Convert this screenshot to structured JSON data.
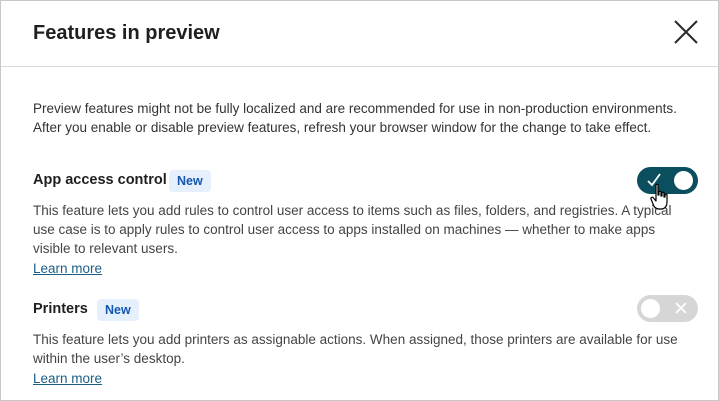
{
  "dialog": {
    "title": "Features in preview",
    "intro_line1": "Preview features might not be fully localized and are recommended for use in non-production environments.",
    "intro_line2": "After you enable or disable preview features, refresh your browser window for the change to take effect."
  },
  "features": [
    {
      "title": "App access control",
      "badge": "New",
      "description": "This feature lets you add rules to control user access to items such as files, folders, and registries. A typical use case is to apply rules to control user access to apps installed on machines — whether to make apps visible to relevant users.",
      "link": "Learn more",
      "enabled": true
    },
    {
      "title": "Printers",
      "badge": "New",
      "description": "This feature lets you add printers as assignable actions. When assigned, those printers are available for use within the user’s desktop.",
      "link": "Learn more",
      "enabled": false
    }
  ],
  "colors": {
    "toggle_on": "#0b4f5e",
    "toggle_off": "#d6d6d6",
    "badge_bg": "#e6f0fc",
    "badge_text": "#1557b0",
    "link": "#1a5f85"
  },
  "icons": {
    "close": "close-icon",
    "check": "check-icon",
    "x": "x-icon",
    "cursor": "hand-pointer-icon"
  }
}
